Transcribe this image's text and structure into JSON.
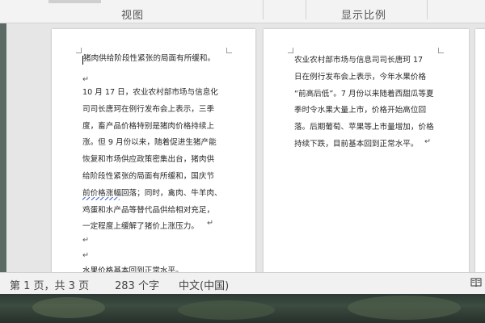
{
  "ribbon": {
    "groups": [
      {
        "label": "视图"
      },
      {
        "label": "显示比例"
      }
    ]
  },
  "pages": {
    "page1": {
      "heading_line": "猪肉供给阶段性紧张的局面有所缓和。",
      "body": "10 月 17 日，农业农村部市场与信息化\n司司长唐珂在例行发布会上表示，三季\n度，畜产品价格特别是猪肉价格持续上\n涨。但 9 月份以来，随着促进生猪产能\n恢复和市场供应政策密集出台，猪肉供\n给阶段性紧张的局面有所缓和，国庆节\n前价格涨幅回落；同时，禽肉、牛羊肉、\n鸡蛋和水产品等替代品供给相对充足，\n一定程度上缓解了猪价上涨压力。",
      "next_line_partial": "水果价格基本回到正常水平。"
    },
    "page2": {
      "body": "农业农村部市场与信息司司长唐珂 17\n日在例行发布会上表示，今年水果价格\n“前高后低”。7 月份以来随着西甜瓜等夏\n季时令水果大量上市，价格开始高位回\n落。后期葡萄、苹果等上市量增加，价格\n持续下跌，目前基本回到正常水平。"
    }
  },
  "statusbar": {
    "page_info": "第 1 页，共 3 页",
    "word_count": "283 个字",
    "language": "中文(中国)"
  },
  "icons": {
    "read_mode": "book-icon"
  }
}
